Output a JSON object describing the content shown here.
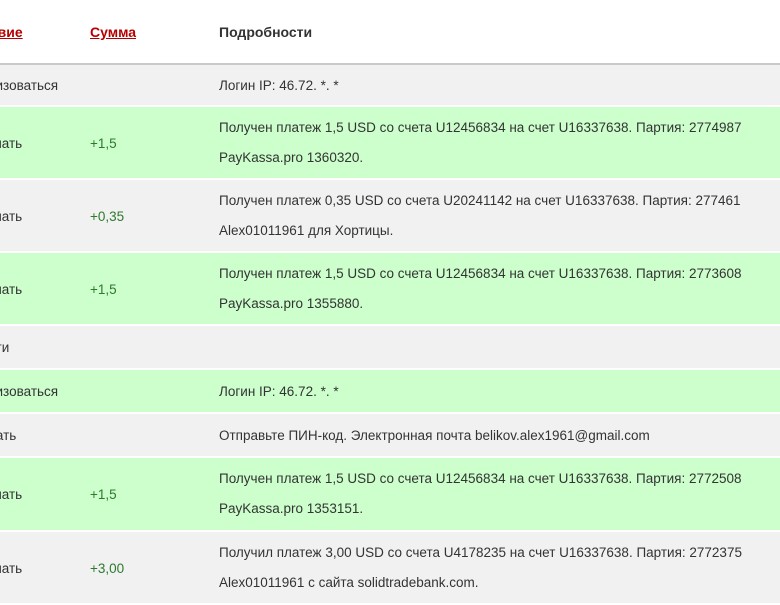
{
  "headers": {
    "action": "ствие",
    "amount": "Сумма",
    "details": "Подробности"
  },
  "rows": [
    {
      "type": "gray",
      "action": "ризоваться",
      "amount": "",
      "details": [
        "Логин IP: 46.72. *. *"
      ]
    },
    {
      "type": "green",
      "action": "учать",
      "amount": "+1,5",
      "details": [
        "Получен платеж 1,5 USD со счета U12456834 на счет U16337638. Партия: 2774987",
        "PayKassa.pro 1360320."
      ]
    },
    {
      "type": "gray",
      "action": "учать",
      "amount": "+0,35",
      "details": [
        "Получен платеж 0,35 USD со счета U20241142 на счет U16337638. Партия: 277461",
        "Alex01011961 для Хортицы."
      ]
    },
    {
      "type": "green",
      "action": "учать",
      "amount": "+1,5",
      "details": [
        "Получен платеж 1,5 USD со счета U12456834 на счет U16337638. Партия: 2773608",
        "PayKassa.pro 1355880."
      ]
    },
    {
      "type": "gray",
      "action": "йти",
      "amount": "",
      "details": []
    },
    {
      "type": "green",
      "action": "ризоваться",
      "amount": "",
      "details": [
        "Логин IP: 46.72. *. *"
      ]
    },
    {
      "type": "gray",
      "action": "лать",
      "amount": "",
      "details": [
        "Отправьте ПИН-код. Электронная почта belikov.alex1961@gmail.com"
      ]
    },
    {
      "type": "green",
      "action": "учать",
      "amount": "+1,5",
      "details": [
        "Получен платеж 1,5 USD со счета U12456834 на счет U16337638. Партия: 2772508",
        "PayKassa.pro 1353151."
      ]
    },
    {
      "type": "gray",
      "action": "учать",
      "amount": "+3,00",
      "details": [
        "Получил платеж 3,00 USD со счета U4178235 на счет U16337638. Партия: 2772375",
        "Alex01011961 с сайта solidtradebank.com."
      ]
    }
  ],
  "colors": {
    "header_link": "#b40000",
    "row_green": "#ccffcc",
    "row_gray": "#f1f1f1",
    "amount": "#2d7a2d"
  }
}
